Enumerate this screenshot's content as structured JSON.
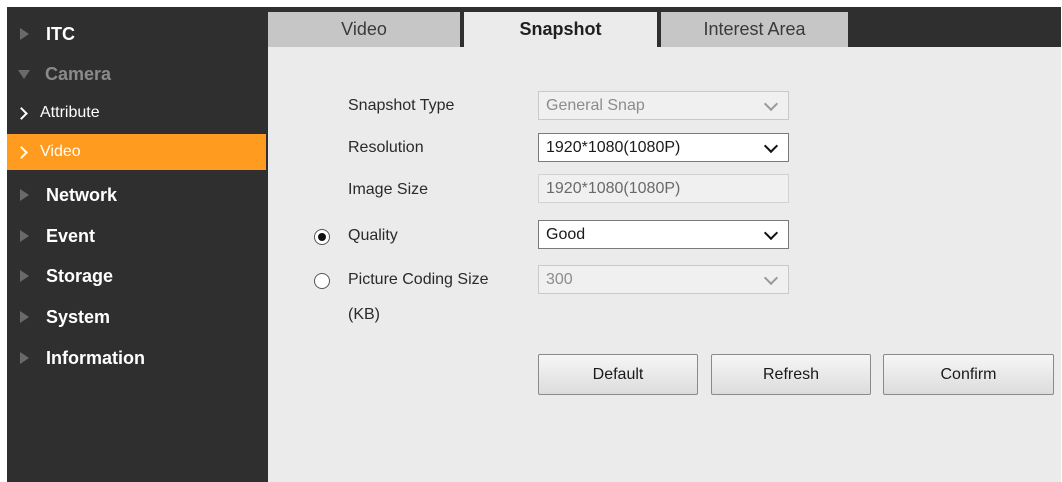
{
  "sidebar": {
    "itc": "ITC",
    "camera": "Camera",
    "attribute": "Attribute",
    "video": "Video",
    "network": "Network",
    "event": "Event",
    "storage": "Storage",
    "system": "System",
    "information": "Information",
    "active_color": "#ff9b1f"
  },
  "tabs": {
    "video": "Video",
    "snapshot": "Snapshot",
    "interest_area": "Interest Area",
    "active": "Snapshot"
  },
  "form": {
    "snapshot_type_label": "Snapshot Type",
    "snapshot_type_value": "General Snap",
    "resolution_label": "Resolution",
    "resolution_value": "1920*1080(1080P)",
    "image_size_label": "Image Size",
    "image_size_value": "1920*1080(1080P)",
    "quality_label": "Quality",
    "quality_value": "Good",
    "coding_size_label": "Picture Coding Size",
    "coding_size_unit": "(KB)",
    "coding_size_value": "300",
    "selected_mode": "quality"
  },
  "buttons": {
    "default": "Default",
    "refresh": "Refresh",
    "confirm": "Confirm"
  }
}
